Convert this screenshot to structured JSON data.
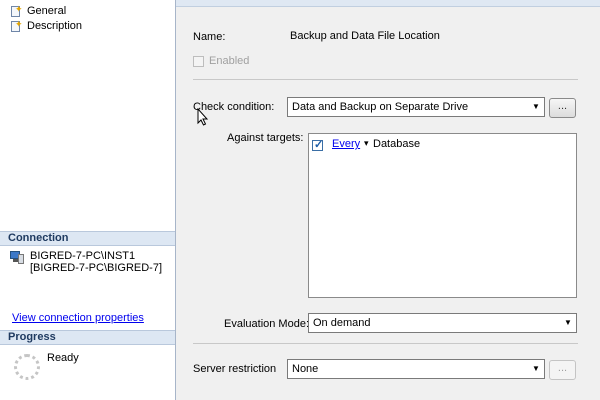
{
  "left": {
    "pages": [
      {
        "label": "General",
        "icon": "page-icon"
      },
      {
        "label": "Description",
        "icon": "page-icon"
      }
    ],
    "connection": {
      "header": "Connection",
      "server": "BIGRED-7-PC\\INST1",
      "user": "[BIGRED-7-PC\\BIGRED-7]",
      "icon": "server-connection-icon",
      "link": "View connection properties"
    },
    "progress": {
      "header": "Progress",
      "status": "Ready",
      "icon": "spinner-icon"
    }
  },
  "form": {
    "name_label": "Name:",
    "name_value": "Backup and Data File Location",
    "enabled_label": "Enabled",
    "check_condition_label": "Check condition:",
    "check_condition_value": "Data and Backup on Separate Drive",
    "ellipsis": "...",
    "against_targets_label": "Against targets:",
    "target_link": "Every",
    "target_arrow": "▾",
    "target_type": "Database",
    "evaluation_mode_label": "Evaluation Mode:",
    "evaluation_mode_value": "On demand",
    "server_restriction_label": "Server restriction",
    "server_restriction_value": "None"
  },
  "colors": {
    "section_header_bg": "#dde7f3",
    "link": "#0000ee",
    "pane_bg": "#f0f0f0"
  }
}
